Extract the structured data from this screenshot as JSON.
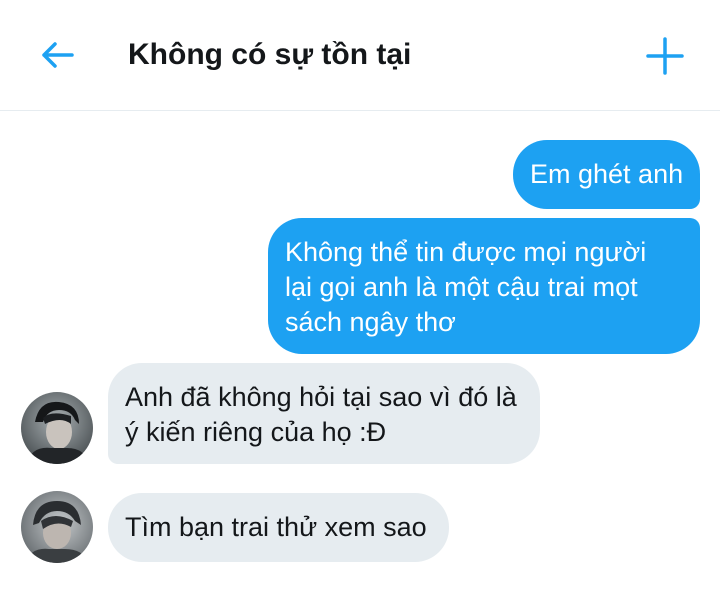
{
  "header": {
    "title": "Không có sự tồn tại",
    "back_icon": "arrow-left-icon",
    "add_icon": "plus-icon",
    "accent_color": "#1da1f2"
  },
  "messages": [
    {
      "direction": "outgoing",
      "lines": [
        "Em ghét anh"
      ]
    },
    {
      "direction": "outgoing",
      "lines": [
        "Không thể tin được mọi người",
        "lại gọi anh là một cậu trai mọt",
        "sách ngây thơ"
      ]
    },
    {
      "direction": "incoming",
      "avatar": "avatar-photo",
      "lines": [
        "Anh đã không hỏi tại sao vì đó là",
        "ý kiến riêng của họ :Đ"
      ]
    },
    {
      "direction": "incoming",
      "avatar": "avatar-photo",
      "lines": [
        "Tìm bạn trai thử xem sao"
      ]
    }
  ],
  "colors": {
    "outgoing_bubble": "#1da1f2",
    "incoming_bubble": "#e6ecf0"
  }
}
